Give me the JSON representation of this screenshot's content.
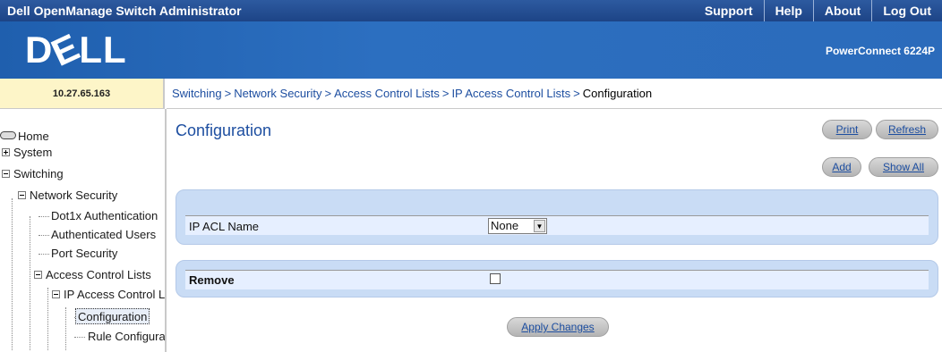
{
  "topbar": {
    "title": "Dell OpenManage Switch Administrator",
    "links": [
      "Support",
      "Help",
      "About",
      "Log Out"
    ]
  },
  "logo": {
    "text_left": "D",
    "text_tilt": "E",
    "text_right": "LL"
  },
  "product": "PowerConnect 6224P",
  "ip_address": "10.27.65.163",
  "breadcrumb": {
    "items": [
      "Switching",
      "Network Security",
      "Access Control Lists",
      "IP Access Control Lists"
    ],
    "current": "Configuration",
    "separator": ">"
  },
  "sidebar": {
    "home": "Home",
    "system": "System",
    "switching": "Switching",
    "network_security": "Network Security",
    "dot1x": "Dot1x Authentication",
    "auth_users": "Authenticated Users",
    "port_security": "Port Security",
    "acl": "Access Control Lists",
    "ip_acl": "IP Access Control Lists",
    "configuration": "Configuration",
    "rule_configuration": "Rule Configuration"
  },
  "main": {
    "title": "Configuration",
    "print": "Print",
    "refresh": "Refresh",
    "add": "Add",
    "show_all": "Show All",
    "acl_name_label": "IP ACL Name",
    "acl_name_value": "None",
    "remove_label": "Remove",
    "remove_checked": false,
    "apply": "Apply Changes"
  }
}
